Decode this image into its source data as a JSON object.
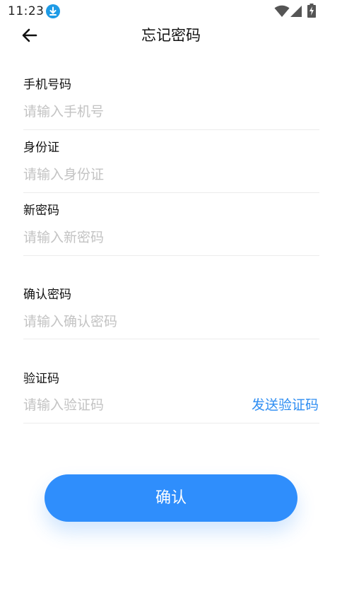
{
  "status_bar": {
    "time": "11:23",
    "icons": [
      "download-icon",
      "wifi-icon",
      "signal-icon",
      "battery-icon"
    ]
  },
  "header": {
    "back_icon": "arrow-left-icon",
    "title": "忘记密码"
  },
  "form": {
    "phone": {
      "label": "手机号码",
      "placeholder": "请输入手机号",
      "value": ""
    },
    "id_card": {
      "label": "身份证",
      "placeholder": "请输入身份证",
      "value": ""
    },
    "new_password": {
      "label": "新密码",
      "placeholder": "请输入新密码",
      "value": ""
    },
    "confirm_password": {
      "label": "确认密码",
      "placeholder": "请输入确认密码",
      "value": ""
    },
    "verification_code": {
      "label": "验证码",
      "placeholder": "请输入验证码",
      "value": "",
      "send_code_label": "发送验证码"
    }
  },
  "confirm_button": {
    "label": "确认"
  },
  "colors": {
    "primary": "#2f8efc",
    "link": "#2f8ef2",
    "placeholder": "#c3c3c3",
    "divider": "#ececec",
    "download_badge": "#1e9be6"
  }
}
